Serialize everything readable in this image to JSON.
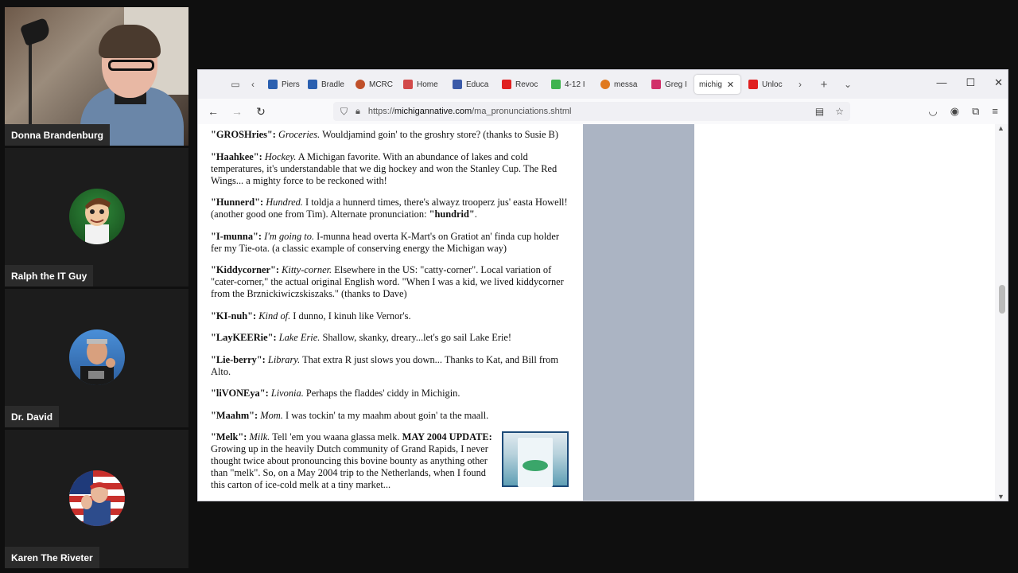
{
  "participants": [
    {
      "name": "Donna Brandenburg",
      "video": true
    },
    {
      "name": "Ralph the IT Guy",
      "avatar": "cartoon-scientist-avatar"
    },
    {
      "name": "Dr. David",
      "avatar": "man-portrait-avatar"
    },
    {
      "name": "Karen The Riveter",
      "avatar": "riveter-avatar"
    }
  ],
  "browser": {
    "tabs": [
      {
        "label": "Pierso",
        "color": "#2a5fb0"
      },
      {
        "label": "Bradle",
        "color": "#2a5fb0"
      },
      {
        "label": "MCRC",
        "color": "#c0502a"
      },
      {
        "label": "Home",
        "color": "#d24a4a"
      },
      {
        "label": "Educa",
        "color": "#3b5aa8"
      },
      {
        "label": "Revoc",
        "color": "#e02020"
      },
      {
        "label": "4-12 I",
        "color": "#3fb34f"
      },
      {
        "label": "messa",
        "color": "#e07a20"
      },
      {
        "label": "Greg I",
        "color": "#d1306a"
      },
      {
        "label": "michig",
        "color": "#ffffff",
        "active": true
      },
      {
        "label": "Unloc",
        "color": "#e02020"
      }
    ],
    "url_prefix": "https://",
    "url_domain": "michigannative.com",
    "url_path": "/ma_pronunciations.shtml"
  },
  "entries": [
    {
      "term": "\"GROSHries\":",
      "meaning": "Groceries.",
      "text": " Wouldjamind goin' to the groshry store? (thanks to Susie B)"
    },
    {
      "term": "\"Haahkee\":",
      "meaning": "Hockey.",
      "text": " A Michigan favorite. With an abundance of lakes and cold temperatures, it's understandable that we dig hockey and won the Stanley Cup. The Red Wings... a mighty force to be reckoned with!"
    },
    {
      "term": "\"Hunnerd\":",
      "meaning": "Hundred.",
      "text": " I toldja a hunnerd times, there's alwayz trooperz jus' easta Howell! (another good one from Tim). Alternate pronunciation: ",
      "extra_bold": "\"hundrid\"",
      "tail": "."
    },
    {
      "term": "\"I-munna\":",
      "meaning": "I'm going to.",
      "text": " I-munna head overta K-Mart's on Gratiot an' finda cup holder fer my Tie-ota. (a classic example of conserving energy the Michigan way)"
    },
    {
      "term": "\"Kiddycorner\":",
      "meaning": "Kitty-corner.",
      "text": " Elsewhere in the US: \"catty-corner\". Local variation of \"cater-corner,\" the actual original English word. \"When I was a kid, we lived kiddycorner from the Brznickiwiczskiszaks.\" (thanks to Dave)"
    },
    {
      "term": "\"KI-nuh\":",
      "meaning": "Kind of.",
      "text": " I dunno, I kinuh like Vernor's."
    },
    {
      "term": "\"LayKEERie\":",
      "meaning": "Lake Erie.",
      "text": " Shallow, skanky, dreary...let's go sail Lake Erie!"
    },
    {
      "term": "\"Lie-berry\":",
      "meaning": "Library.",
      "text": " That extra R just slows you down... Thanks to Kat, and Bill from Alto."
    },
    {
      "term": "\"liVONEya\":",
      "meaning": "Livonia.",
      "text": " Perhaps the fladdes' ciddy in Michigin."
    },
    {
      "term": "\"Maahm\":",
      "meaning": "Mom.",
      "text": " I was tockin' ta my maahm about goin' ta the maall."
    }
  ],
  "melk": {
    "term": "\"Melk\":",
    "meaning": "Milk.",
    "text1": " Tell 'em you waana glassa melk. ",
    "update": "MAY 2004 UPDATE:",
    "text2": " Growing up in the heavily Dutch community of Grand Rapids, I never thought twice about pronouncing this bovine bounty as anything other than \"melk\". So, on a May 2004 trip to the Netherlands, when I found this carton of ice-cold melk at a tiny market..."
  }
}
